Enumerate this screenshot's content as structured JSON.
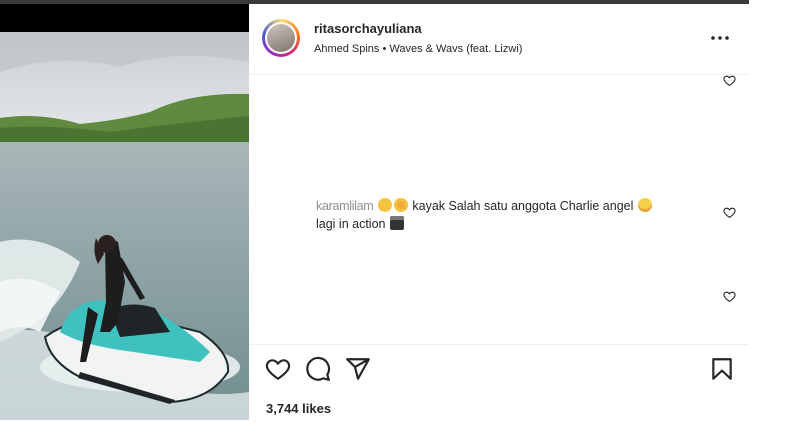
{
  "post": {
    "username": "ritasorchayuliana",
    "audio": "Ahmed Spins • Waves & Wavs (feat. Lizwi)",
    "likes": "3,744 likes"
  },
  "comments": [
    {
      "user": "karamlilam",
      "text_part1": " kayak Salah satu anggota Charlie angel ",
      "text_part2": "lagi in action ",
      "emojis": [
        "clapping-hands",
        "star-struck",
        "smiling-face",
        "clapper-board"
      ]
    }
  ],
  "icons": {
    "more": "more-options-icon",
    "like": "heart-icon",
    "comment": "comment-bubble-icon",
    "share": "paper-plane-icon",
    "save": "bookmark-icon"
  },
  "colors": {
    "text": "#262626",
    "muted": "#8e8e8e",
    "jetski_teal": "#3fc1c0",
    "divider": "#efefef"
  }
}
